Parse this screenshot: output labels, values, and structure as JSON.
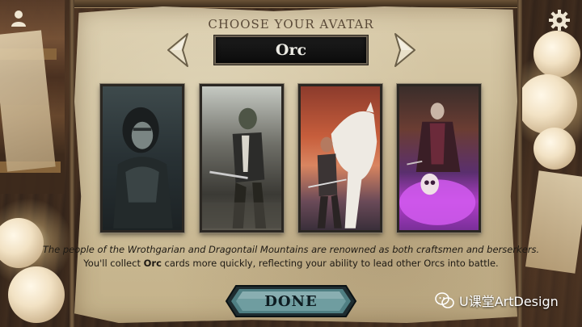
{
  "screen": {
    "title": "CHOOSE YOUR AVATAR",
    "selected_race": "Orc"
  },
  "navigation": {
    "prev_icon": "chevron-left-icon",
    "next_icon": "chevron-right-icon"
  },
  "avatars": [
    {
      "id": "avatar-1"
    },
    {
      "id": "avatar-2"
    },
    {
      "id": "avatar-3"
    },
    {
      "id": "avatar-4"
    }
  ],
  "description": {
    "line1": "The people of the Wrothgarian and Dragontail Mountains are renowned as both craftsmen and berserkers.",
    "line2_prefix": "You'll collect ",
    "line2_bold": "Orc",
    "line2_suffix": " cards more quickly, reflecting your ability to lead other Orcs into battle."
  },
  "done_button": {
    "label": "DONE"
  },
  "corner_icons": {
    "left": "profile-icon",
    "right": "gear-icon"
  },
  "watermark": {
    "text": "U课堂ArtDesign"
  },
  "colors": {
    "parchment": "#d4c5a2",
    "name_box": "#111111",
    "button_teal": "#3f6f73",
    "text_dark": "#1e1a14"
  }
}
